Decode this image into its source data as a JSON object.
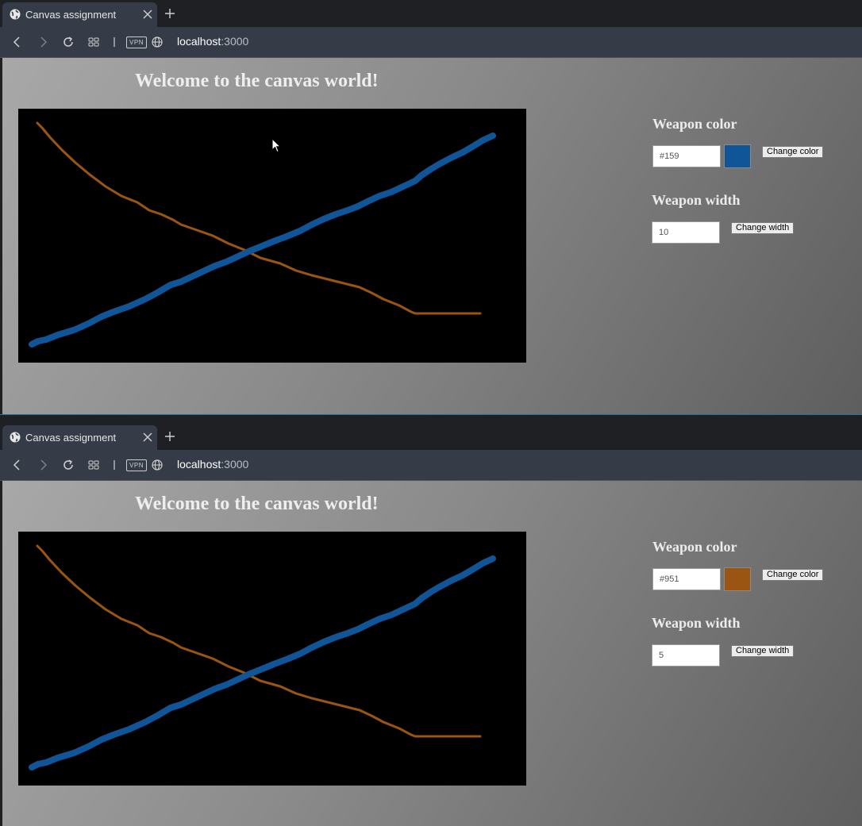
{
  "windows": [
    {
      "tab_title": "Canvas assignment",
      "url_host": "localhost",
      "url_port": ":3000",
      "vpn_label": "VPN",
      "heading": "Welcome to the canvas world!",
      "weapon_color_label": "Weapon color",
      "color_value": "#159",
      "swatch_color": "#115599",
      "change_color_label": "Change color",
      "weapon_width_label": "Weapon width",
      "width_value": "10",
      "change_width_label": "Change width"
    },
    {
      "tab_title": "Canvas assignment",
      "url_host": "localhost",
      "url_port": ":3000",
      "vpn_label": "VPN",
      "heading": "Welcome to the canvas world!",
      "weapon_color_label": "Weapon color",
      "color_value": "#951",
      "swatch_color": "#995511",
      "change_color_label": "Change color",
      "weapon_width_label": "Weapon width",
      "width_value": "5",
      "change_width_label": "Change width"
    }
  ],
  "strokes": {
    "blue": "#115599",
    "orange": "#995511"
  }
}
